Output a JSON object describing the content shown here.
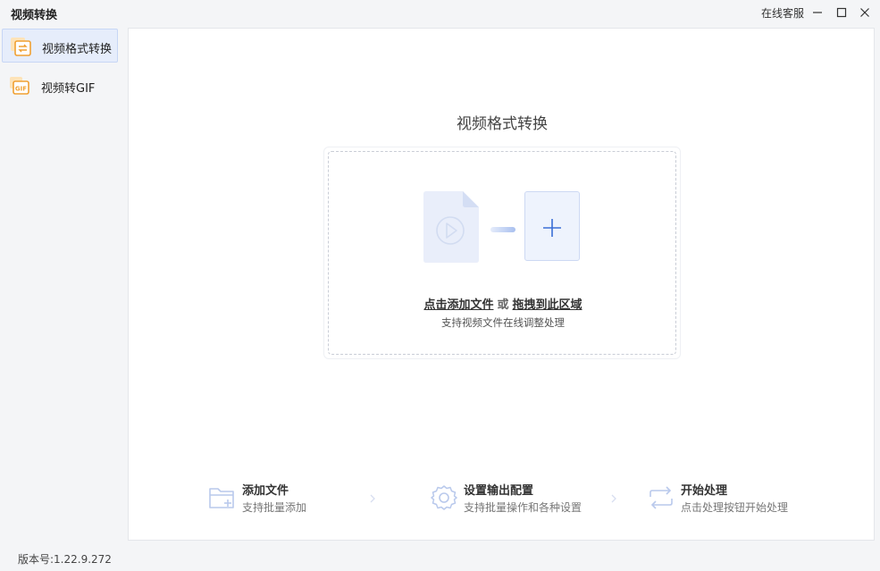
{
  "app": {
    "title": "视频转换",
    "service_label": "在线客服",
    "version": "版本号:1.22.9.272"
  },
  "window_controls": {
    "minimize_icon": "minimize-icon",
    "maximize_icon": "maximize-icon",
    "close_icon": "close-icon"
  },
  "sidebar": {
    "items": [
      {
        "label": "视频格式转换",
        "icon": "video-convert-icon",
        "active": true
      },
      {
        "label": "视频转GIF",
        "icon": "gif-icon",
        "active": false
      }
    ]
  },
  "main": {
    "title": "视频格式转换",
    "drop": {
      "click_add": "点击添加文件",
      "or": "或",
      "drag": "拖拽到此区域",
      "subtitle": "支持视频文件在线调整处理"
    },
    "steps": [
      {
        "title": "添加文件",
        "desc": "支持批量添加",
        "icon": "folder-add-icon"
      },
      {
        "title": "设置输出配置",
        "desc": "支持批量操作和各种设置",
        "icon": "gear-icon"
      },
      {
        "title": "开始处理",
        "desc": "点击处理按钮开始处理",
        "icon": "repeat-icon"
      }
    ]
  },
  "colors": {
    "accent": "#3b6fd6",
    "orange": "#f0a032",
    "active_bg": "#e6edfb"
  }
}
